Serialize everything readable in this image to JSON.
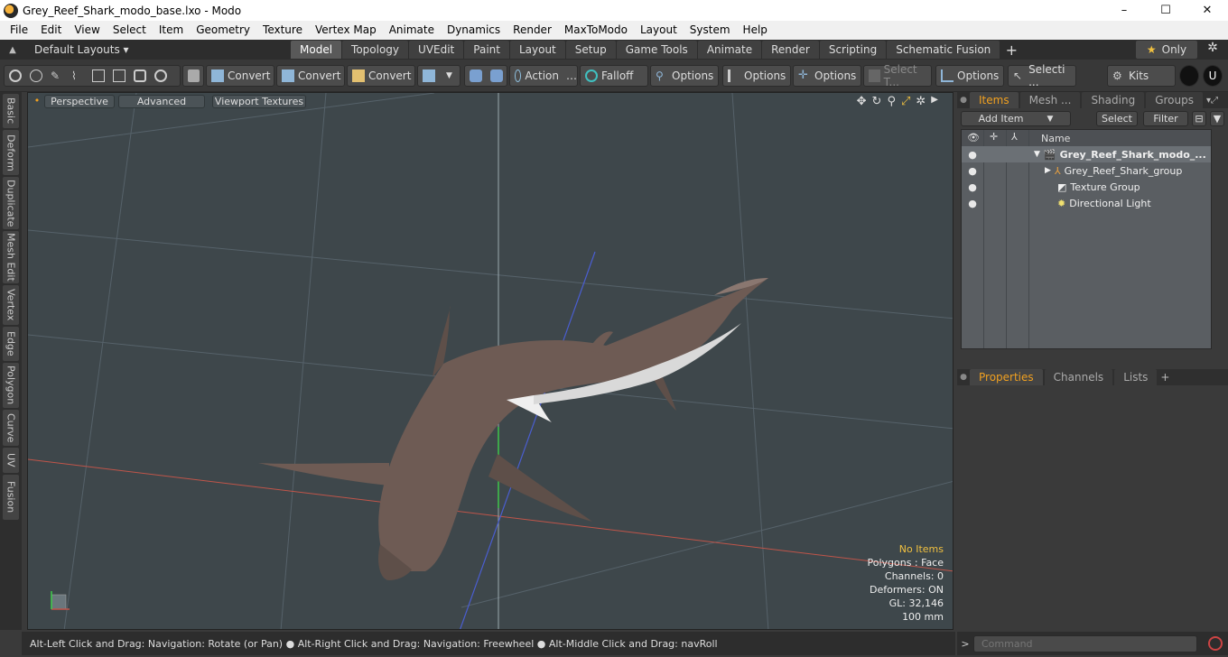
{
  "window": {
    "title": "Grey_Reef_Shark_modo_base.lxo - Modo",
    "controls": [
      "–",
      "☐",
      "✕"
    ]
  },
  "menubar": [
    "File",
    "Edit",
    "View",
    "Select",
    "Item",
    "Geometry",
    "Texture",
    "Vertex Map",
    "Animate",
    "Dynamics",
    "Render",
    "MaxToModo",
    "Layout",
    "System",
    "Help"
  ],
  "layouts": {
    "label": "Default Layouts ▾",
    "tabs": [
      "Model",
      "Topology",
      "UVEdit",
      "Paint",
      "Layout",
      "Setup",
      "Game Tools",
      "Animate",
      "Render",
      "Scripting",
      "Schematic Fusion"
    ],
    "active_tab": "Model",
    "only_label": "Only"
  },
  "toolbar": {
    "convert1": "Convert",
    "convert2": "Convert",
    "convert3": "Convert",
    "action": "Action",
    "falloff": "Falloff",
    "options1": "Options",
    "options2": "Options",
    "options3": "Options",
    "select_t": "Select T...",
    "options4": "Options",
    "selecti": "Selecti ...",
    "kits": "Kits"
  },
  "left_tabs": [
    "Basic",
    "Deform",
    "Duplicate",
    "Mesh Edit",
    "Vertex",
    "Edge",
    "Polygon",
    "Curve",
    "UV",
    "Fusion"
  ],
  "viewport": {
    "perspective": "Perspective",
    "advanced": "Advanced",
    "viewport_textures": "Viewport Textures",
    "stats": {
      "no_items": "No Items",
      "polygons": "Polygons : Face",
      "channels": "Channels: 0",
      "deformers": "Deformers: ON",
      "gl": "GL: 32,146",
      "scale": "100 mm"
    }
  },
  "statusbar": {
    "text": "Alt-Left Click and Drag: Navigation: Rotate (or Pan) ● Alt-Right Click and Drag: Navigation: Freewheel ● Alt-Middle Click and Drag: navRoll"
  },
  "items_panel": {
    "tabs": [
      "Items",
      "Mesh ...",
      "Shading",
      "Groups"
    ],
    "active_tab": "Items",
    "add_item": "Add Item",
    "select": "Select",
    "filter": "Filter",
    "column_name": "Name",
    "rows": [
      {
        "label": "Grey_Reef_Shark_modo_...",
        "bold": true
      },
      {
        "label": "Grey_Reef_Shark_group",
        "bold": false
      },
      {
        "label": "Texture Group",
        "bold": false
      },
      {
        "label": "Directional Light",
        "bold": false
      }
    ]
  },
  "properties_panel": {
    "tabs": [
      "Properties",
      "Channels",
      "Lists"
    ],
    "active_tab": "Properties"
  },
  "command": {
    "placeholder": "Command"
  }
}
